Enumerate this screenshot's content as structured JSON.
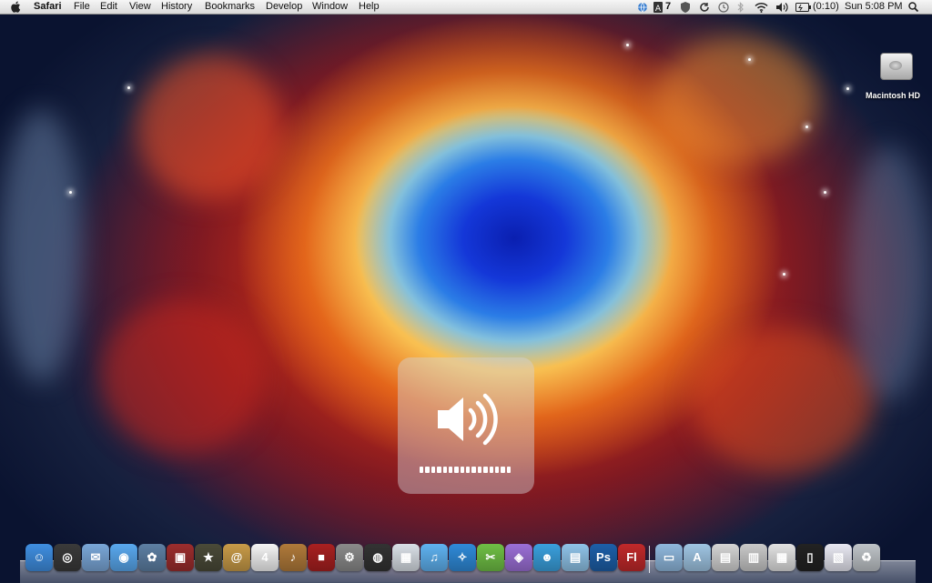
{
  "menubar": {
    "app_name": "Safari",
    "menus": [
      "File",
      "Edit",
      "View",
      "History",
      "Bookmarks",
      "Develop",
      "Window",
      "Help"
    ],
    "status": {
      "notification_count": "7",
      "battery_time": "(0:10)",
      "clock": "Sun 5:08 PM"
    }
  },
  "desktop": {
    "drive_label": "Macintosh HD"
  },
  "volume_hud": {
    "level_fraction": 1.0,
    "segments": 16
  },
  "dock": {
    "apps": [
      {
        "name": "Finder",
        "color": "#3f8ee0",
        "icon": "finder-icon",
        "glyph": "☺"
      },
      {
        "name": "Dashboard",
        "color": "#3a3a3a",
        "icon": "dashboard-icon",
        "glyph": "◎"
      },
      {
        "name": "Preview",
        "color": "#7aa7d8",
        "icon": "preview-icon",
        "glyph": "✉"
      },
      {
        "name": "iChat",
        "color": "#59a8ee",
        "icon": "ichat-icon",
        "glyph": "◉"
      },
      {
        "name": "iPhoto",
        "color": "#5d7fa3",
        "icon": "iphoto-icon",
        "glyph": "✿"
      },
      {
        "name": "Photo Booth",
        "color": "#9b2d2d",
        "icon": "photobooth-icon",
        "glyph": "▣"
      },
      {
        "name": "iMovie",
        "color": "#4a4a38",
        "icon": "imovie-icon",
        "glyph": "★"
      },
      {
        "name": "Address Book",
        "color": "#c89b48",
        "icon": "addressbook-icon",
        "glyph": "@"
      },
      {
        "name": "iCal",
        "color": "#f4f4f4",
        "icon": "ical-icon",
        "glyph": "4"
      },
      {
        "name": "GarageBand",
        "color": "#b07a3a",
        "icon": "garageband-icon",
        "glyph": "♪"
      },
      {
        "name": "Front Row",
        "color": "#a82020",
        "icon": "frontrow-icon",
        "glyph": "■"
      },
      {
        "name": "System Preferences",
        "color": "#8a8a8a",
        "icon": "gear-icon",
        "glyph": "⚙"
      },
      {
        "name": "Aperture",
        "color": "#333333",
        "icon": "aperture-icon",
        "glyph": "◍"
      },
      {
        "name": "Calculator",
        "color": "#d9dfe6",
        "icon": "calculator-icon",
        "glyph": "▦"
      },
      {
        "name": "iTunes",
        "color": "#5fb2f0",
        "icon": "itunes-icon",
        "glyph": "♫"
      },
      {
        "name": "Safari",
        "color": "#2f8ad8",
        "icon": "safari-icon",
        "glyph": "✧"
      },
      {
        "name": "Automator",
        "color": "#6fbf45",
        "icon": "automator-icon",
        "glyph": "✂"
      },
      {
        "name": "Cosmic",
        "color": "#9b6fd6",
        "icon": "cosmic-icon",
        "glyph": "◈"
      },
      {
        "name": "Messenger",
        "color": "#3aa0dd",
        "icon": "messenger-icon",
        "glyph": "☻"
      },
      {
        "name": "Preview Docs",
        "color": "#8fc3e8",
        "icon": "preview-docs-icon",
        "glyph": "▤"
      },
      {
        "name": "Photoshop",
        "color": "#1d5fa8",
        "icon": "photoshop-icon",
        "glyph": "Ps"
      },
      {
        "name": "Flash",
        "color": "#c0292a",
        "icon": "flash-icon",
        "glyph": "Fl"
      }
    ],
    "stacks": [
      {
        "name": "Applications",
        "color": "#8fb8dd",
        "icon": "applications-folder-icon",
        "glyph": "▭"
      },
      {
        "name": "Documents",
        "color": "#9fc5e3",
        "icon": "documents-folder-icon",
        "glyph": "A"
      },
      {
        "name": "Downloads",
        "color": "#d4d4d4",
        "icon": "downloads-stack-icon",
        "glyph": "▤"
      },
      {
        "name": "Stack 2",
        "color": "#c9c9c9",
        "icon": "stack-icon",
        "glyph": "▥"
      },
      {
        "name": "Stack 3",
        "color": "#e2e2e2",
        "icon": "stack-icon",
        "glyph": "▦"
      },
      {
        "name": "iPhone",
        "color": "#222222",
        "icon": "iphone-icon",
        "glyph": "▯"
      },
      {
        "name": "Stack 4",
        "color": "#e8e8f2",
        "icon": "stack-icon",
        "glyph": "▧"
      },
      {
        "name": "Trash",
        "color": "#bfc4c8",
        "icon": "trash-icon",
        "glyph": "♻"
      }
    ]
  }
}
